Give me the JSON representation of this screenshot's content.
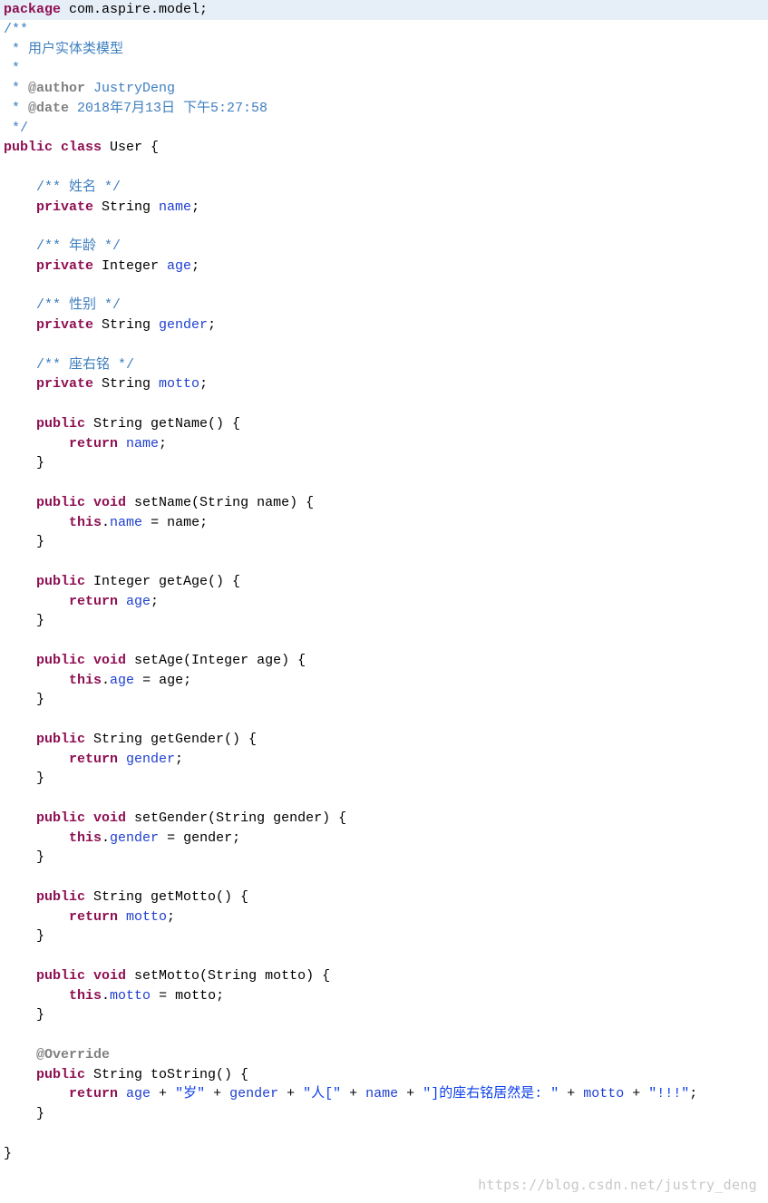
{
  "pkg_kw": "package",
  "pkg_name": " com.aspire.model;",
  "doc_open": "/**",
  "doc_l1": " * 用户实体类模型",
  "doc_l2": " * ",
  "doc_author_star": " * ",
  "doc_author_tag": "@author",
  "doc_author_val": " JustryDeng",
  "doc_date_star": " * ",
  "doc_date_tag": "@date",
  "doc_date_val": " 2018年7月13日 下午5:27:58",
  "doc_close": " */",
  "cls_public": "public ",
  "cls_class": "class",
  "cls_name": " User {",
  "c_name": "    /** 姓名 */",
  "f_name_kw": "    private",
  "f_name_type": " String ",
  "f_name_fld": "name",
  "f_name_semi": ";",
  "c_age": "    /** 年龄 */",
  "f_age_kw": "    private",
  "f_age_type": " Integer ",
  "f_age_fld": "age",
  "f_age_semi": ";",
  "c_gender": "    /** 性别 */",
  "f_gender_kw": "    private",
  "f_gender_type": " String ",
  "f_gender_fld": "gender",
  "f_gender_semi": ";",
  "c_motto": "    /** 座右铭 */",
  "f_motto_kw": "    private",
  "f_motto_type": " String ",
  "f_motto_fld": "motto",
  "f_motto_semi": ";",
  "gn_sig1": "    public",
  "gn_sig2": " String getName() {",
  "gn_ret_kw": "        return",
  "gn_ret_fld": " name",
  "gn_ret_semi": ";",
  "close_brace": "    }",
  "sn_sig1": "    public ",
  "sn_sig_void": "void",
  "sn_sig2": " setName(String name) {",
  "sn_this": "        this",
  "sn_dot": ".",
  "sn_fld": "name",
  "sn_eq": " = name;",
  "ga_sig1": "    public",
  "ga_sig2": " Integer getAge() {",
  "ga_ret_kw": "        return",
  "ga_ret_fld": " age",
  "ga_ret_semi": ";",
  "sa_sig1": "    public ",
  "sa_sig_void": "void",
  "sa_sig2": " setAge(Integer age) {",
  "sa_this": "        this",
  "sa_dot": ".",
  "sa_fld": "age",
  "sa_eq": " = age;",
  "gg_sig1": "    public",
  "gg_sig2": " String getGender() {",
  "gg_ret_kw": "        return",
  "gg_ret_fld": " gender",
  "gg_ret_semi": ";",
  "sg_sig1": "    public ",
  "sg_sig_void": "void",
  "sg_sig2": " setGender(String gender) {",
  "sg_this": "        this",
  "sg_dot": ".",
  "sg_fld": "gender",
  "sg_eq": " = gender;",
  "gm_sig1": "    public",
  "gm_sig2": " String getMotto() {",
  "gm_ret_kw": "        return",
  "gm_ret_fld": " motto",
  "gm_ret_semi": ";",
  "sm_sig1": "    public ",
  "sm_sig_void": "void",
  "sm_sig2": " setMotto(String motto) {",
  "sm_this": "        this",
  "sm_dot": ".",
  "sm_fld": "motto",
  "sm_eq": " = motto;",
  "ov_ann": "    @Override",
  "ts_sig1": "    public",
  "ts_sig2": " String toString() {",
  "ts_ret_kw": "        return",
  "ts_p1_fld": " age",
  "ts_p1_plus": " + ",
  "ts_s1": "\"岁\"",
  "ts_p2_plus": " + ",
  "ts_p2_fld": "gender",
  "ts_p3_plus": " + ",
  "ts_s2": "\"人[\"",
  "ts_p4_plus": " + ",
  "ts_p4_fld": "name",
  "ts_p5_plus": " + ",
  "ts_s3": "\"]的座右铭居然是: \"",
  "ts_p6_plus": " + ",
  "ts_p6_fld": "motto",
  "ts_p7_plus": " + ",
  "ts_s4": "\"!!!\"",
  "ts_semi": ";",
  "cls_close": "}",
  "watermark": "https://blog.csdn.net/justry_deng"
}
